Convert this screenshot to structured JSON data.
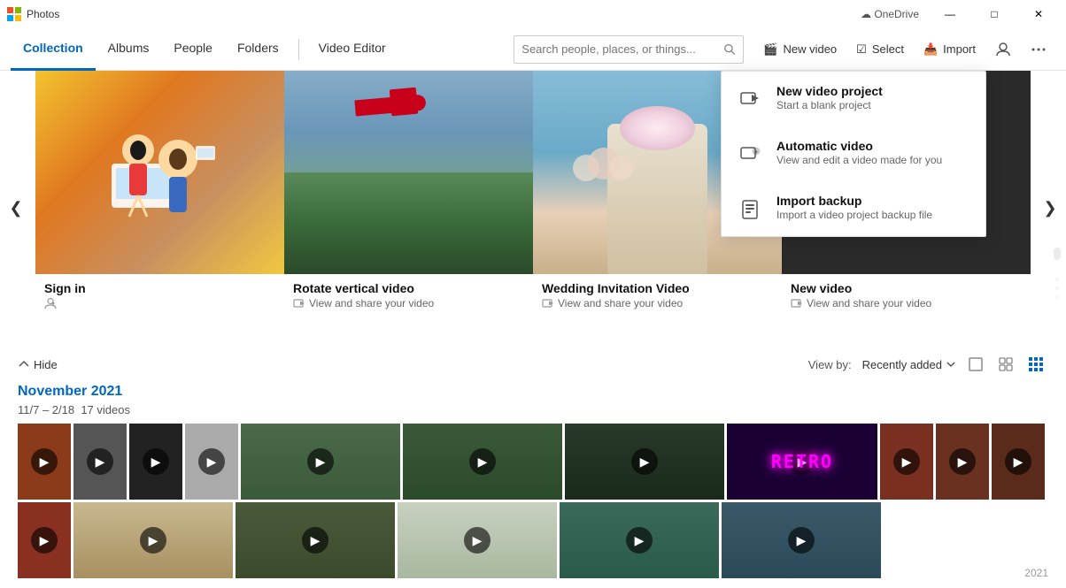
{
  "app": {
    "title": "Photos",
    "onedrive_label": "OneDrive"
  },
  "titlebar": {
    "minimize": "—",
    "maximize": "□",
    "close": "✕"
  },
  "nav": {
    "items": [
      {
        "id": "collection",
        "label": "Collection",
        "active": true
      },
      {
        "id": "albums",
        "label": "Albums",
        "active": false
      },
      {
        "id": "people",
        "label": "People",
        "active": false
      },
      {
        "id": "folders",
        "label": "Folders",
        "active": false
      },
      {
        "id": "video-editor",
        "label": "Video Editor",
        "active": false
      }
    ],
    "search_placeholder": "Search people, places, or things...",
    "actions": [
      {
        "id": "new-video",
        "label": "New video",
        "icon": "🎬"
      },
      {
        "id": "select",
        "label": "Select",
        "icon": "☑"
      },
      {
        "id": "import",
        "label": "Import",
        "icon": "📥"
      }
    ]
  },
  "carousel": {
    "left_arrow": "❮",
    "right_arrow": "❯",
    "items": [
      {
        "id": "signin",
        "title": "Sign in",
        "subtitle": "",
        "bg_type": "gradient_signin"
      },
      {
        "id": "rotate-vertical",
        "title": "Rotate vertical video",
        "subtitle": "View and share your video",
        "bg_type": "aerial"
      },
      {
        "id": "wedding-invitation",
        "title": "Wedding Invitation Video",
        "subtitle": "View and share your video",
        "bg_type": "wedding"
      },
      {
        "id": "new-video-feature",
        "title": "New video",
        "subtitle": "View and share your video",
        "bg_type": "dark_hands"
      }
    ]
  },
  "view_bar": {
    "hide_label": "Hide",
    "view_by_label": "View by:",
    "view_by_selected": "Recently added",
    "view_icons": [
      "⊡",
      "⊞",
      "⊟"
    ]
  },
  "collection": {
    "month": "November 2021",
    "date_range": "11/7 – 2/18",
    "video_count": "17 videos",
    "year_label": "2021"
  },
  "dropdown": {
    "items": [
      {
        "id": "new-video-project",
        "title": "New video project",
        "description": "Start a blank project",
        "icon": "🎬"
      },
      {
        "id": "automatic-video",
        "title": "Automatic video",
        "description": "View and edit a video made for you",
        "icon": "✨"
      },
      {
        "id": "import-backup",
        "title": "Import backup",
        "description": "Import a video project backup file",
        "icon": "💾"
      }
    ]
  }
}
